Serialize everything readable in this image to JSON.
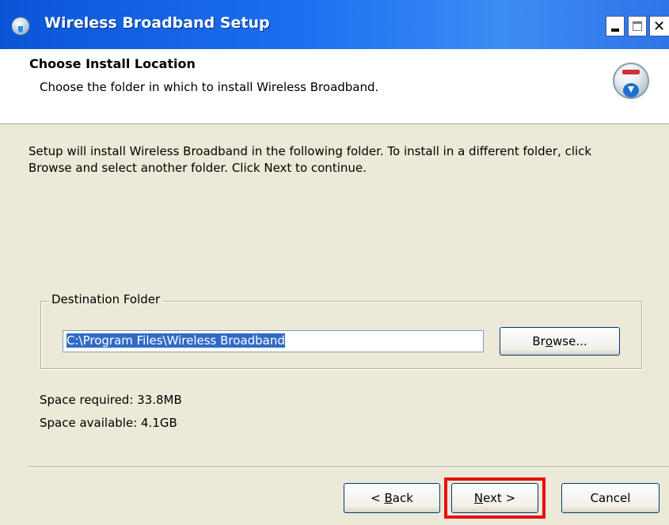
{
  "window": {
    "title": "Wireless Broadband Setup",
    "icon": "installer-disc-icon",
    "controls": {
      "minimize": "minimize-icon",
      "maximize": "maximize-icon",
      "close": "✕"
    }
  },
  "header": {
    "title": "Choose Install Location",
    "subtitle": "Choose the folder in which to install Wireless Broadband.",
    "logo": "install-cd-icon"
  },
  "body": {
    "intro_line1": "Setup will install Wireless Broadband in the following folder. To install in a different folder, click",
    "intro_line2": "Browse and select another folder. Click Next to continue.",
    "destination": {
      "group_label": "Destination Folder",
      "path_value": "C:\\Program Files\\Wireless Broadband",
      "browse_pre": "Br",
      "browse_key": "o",
      "browse_post": "wse..."
    },
    "space_required": "Space required: 33.8MB",
    "space_available": "Space available: 4.1GB"
  },
  "footer": {
    "back_pre": "< ",
    "back_key": "B",
    "back_post": "ack",
    "next_key": "N",
    "next_post": "ext >",
    "cancel_label": "Cancel"
  },
  "colors": {
    "titlebar": "#0a55d6",
    "dialog_background": "#ece9d8",
    "selection": "#316ac5",
    "highlight_box": "#e81010"
  }
}
